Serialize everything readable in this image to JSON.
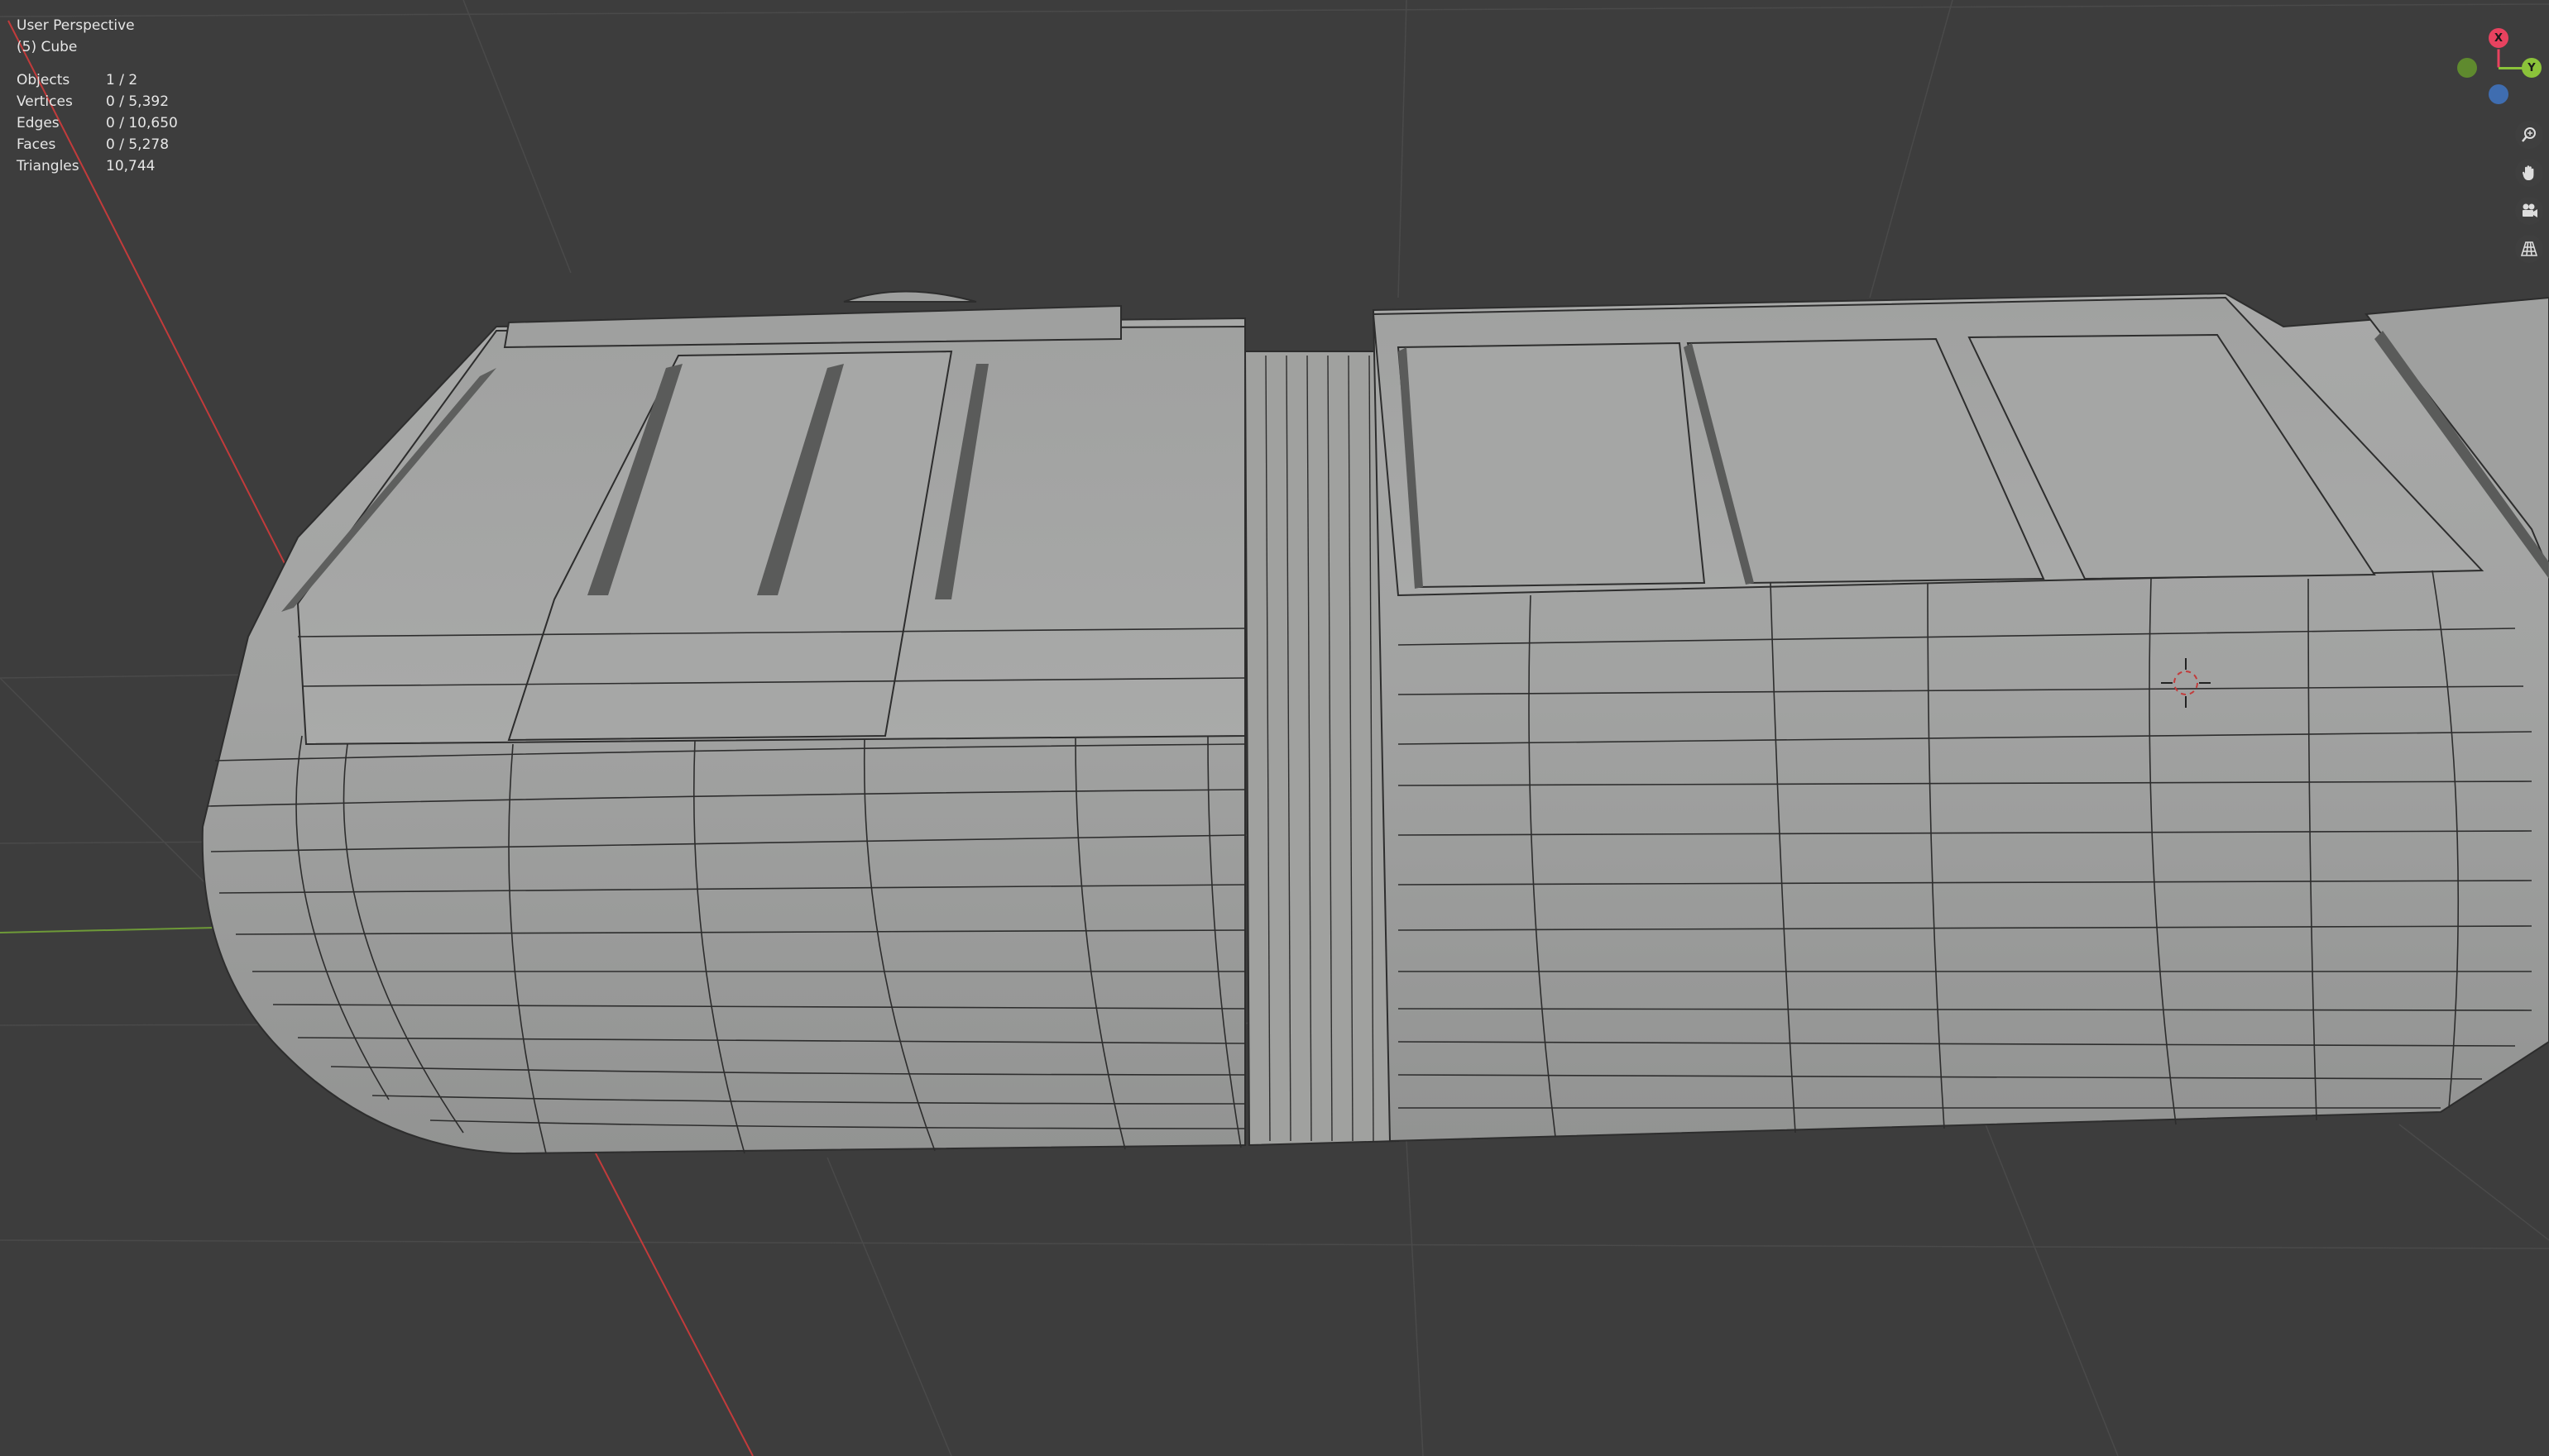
{
  "viewport": {
    "view_label": "User Perspective",
    "object_label": "(5) Cube",
    "stats": [
      {
        "label": "Objects",
        "value": "1 / 2"
      },
      {
        "label": "Vertices",
        "value": "0 / 5,392"
      },
      {
        "label": "Edges",
        "value": "0 / 10,650"
      },
      {
        "label": "Faces",
        "value": "0 / 5,278"
      },
      {
        "label": "Triangles",
        "value": "10,744"
      }
    ]
  },
  "gizmo": {
    "x_label": "X",
    "y_label": "Y",
    "x_color": "#e8425f",
    "y_color": "#8bc33a",
    "z_color": "#4a7ac4",
    "neg_y_color": "#6a9a2e"
  },
  "tools": [
    {
      "name": "zoom-icon"
    },
    {
      "name": "pan-hand-icon"
    },
    {
      "name": "camera-icon"
    },
    {
      "name": "grid-perspective-icon"
    }
  ],
  "colors": {
    "background": "#3d3d3d",
    "mesh": "#a3a4a3",
    "mesh_dark": "#8a8b8a",
    "wire": "#2d2d2d",
    "x_axis": "#c23b3b",
    "y_axis": "#6e9a38"
  }
}
